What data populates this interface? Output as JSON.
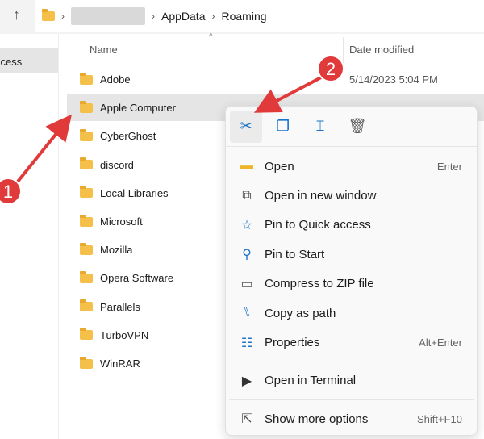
{
  "breadcrumb": {
    "items": [
      "AppData",
      "Roaming"
    ]
  },
  "sidebar": {
    "selected_label": "ccess"
  },
  "columns": {
    "name": "Name",
    "date": "Date modified"
  },
  "files": [
    {
      "name": "Adobe",
      "date": "5/14/2023 5:04 PM"
    },
    {
      "name": "Apple Computer"
    },
    {
      "name": "CyberGhost"
    },
    {
      "name": "discord"
    },
    {
      "name": "Local Libraries"
    },
    {
      "name": "Microsoft"
    },
    {
      "name": "Mozilla"
    },
    {
      "name": "Opera Software"
    },
    {
      "name": "Parallels"
    },
    {
      "name": "TurboVPN"
    },
    {
      "name": "WinRAR"
    }
  ],
  "menu": {
    "items": [
      {
        "label": "Open",
        "shortcut": "Enter"
      },
      {
        "label": "Open in new window"
      },
      {
        "label": "Pin to Quick access"
      },
      {
        "label": "Pin to Start"
      },
      {
        "label": "Compress to ZIP file"
      },
      {
        "label": "Copy as path"
      },
      {
        "label": "Properties",
        "shortcut": "Alt+Enter"
      },
      {
        "label": "Open in Terminal"
      },
      {
        "label": "Show more options",
        "shortcut": "Shift+F10"
      }
    ]
  },
  "annotations": {
    "step1": "1",
    "step2": "2",
    "color": "#e03a3a"
  }
}
